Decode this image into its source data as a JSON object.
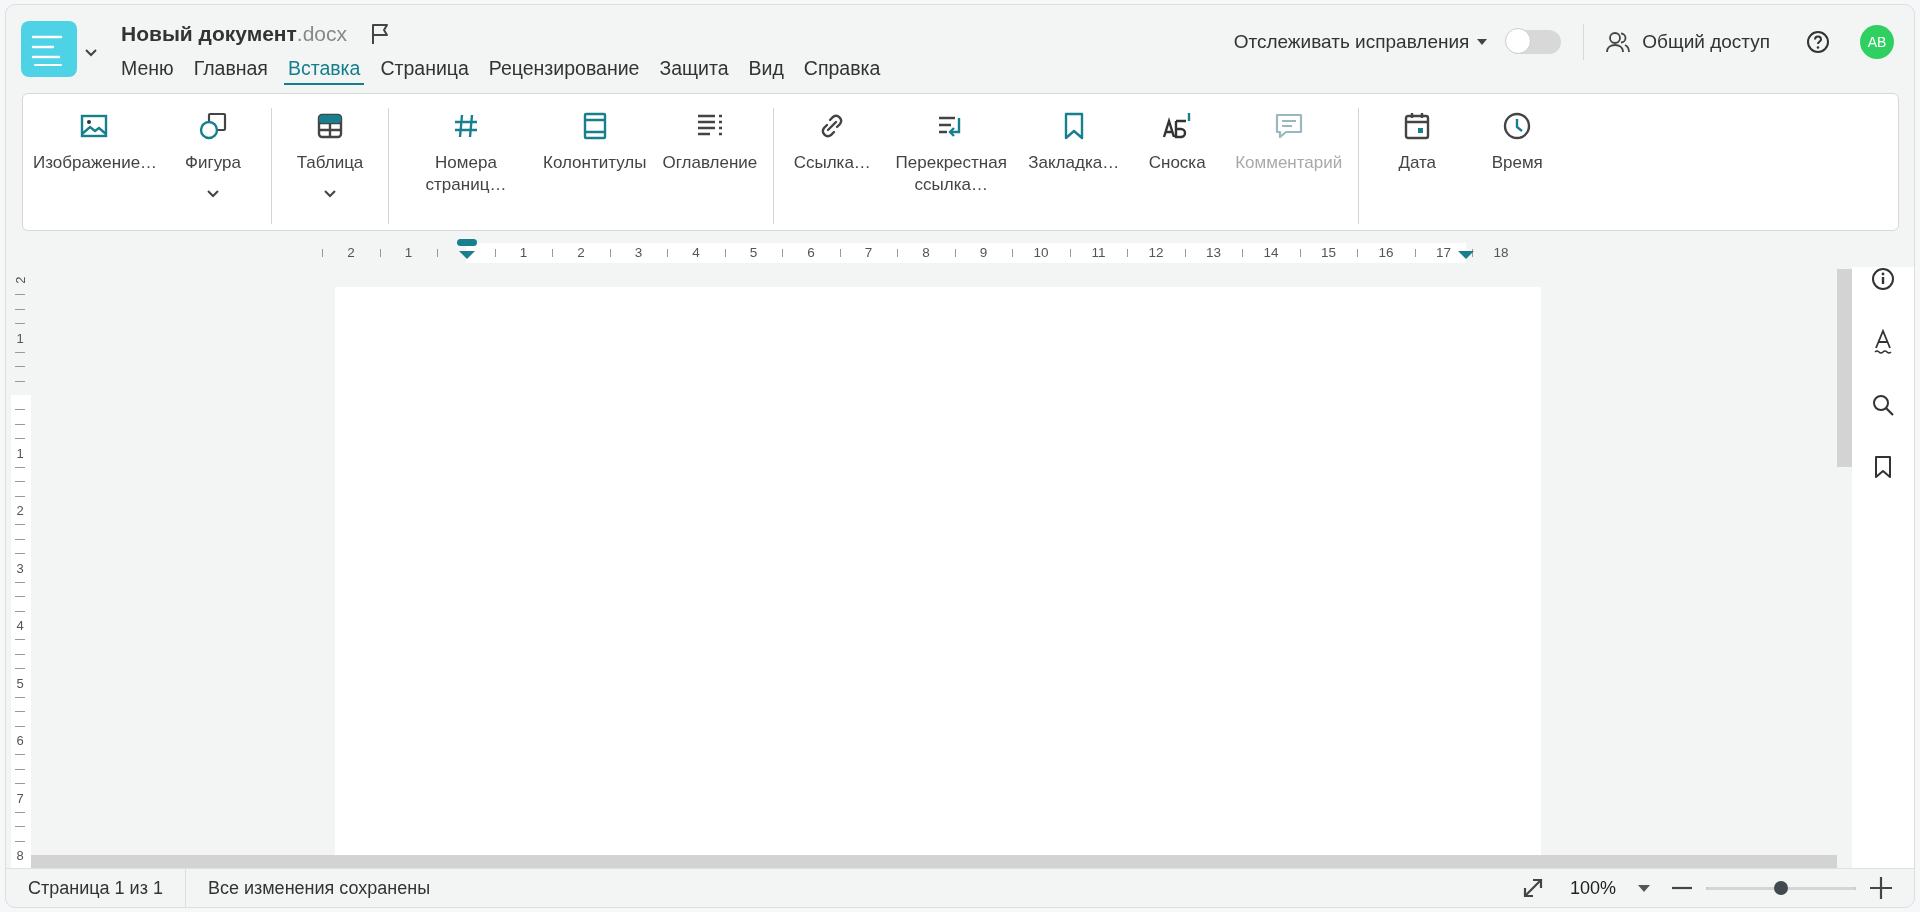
{
  "header": {
    "title": {
      "name": "Новый документ",
      "extension": ".docx"
    },
    "tabs": [
      {
        "label": "Меню",
        "selected": false
      },
      {
        "label": "Главная",
        "selected": false
      },
      {
        "label": "Вставка",
        "selected": true
      },
      {
        "label": "Страница",
        "selected": false
      },
      {
        "label": "Рецензирование",
        "selected": false
      },
      {
        "label": "Защита",
        "selected": false
      },
      {
        "label": "Вид",
        "selected": false
      },
      {
        "label": "Справка",
        "selected": false
      }
    ],
    "track_changes": {
      "label": "Отслеживать исправления",
      "on": false
    },
    "share": {
      "label": "Общий доступ"
    },
    "avatar": {
      "initials": "AB"
    }
  },
  "ribbon": {
    "groups": [
      [
        {
          "label": "Изображение…",
          "has_menu": false,
          "disabled": false
        },
        {
          "label": "Фигура",
          "has_menu": true,
          "disabled": false
        }
      ],
      [
        {
          "label": "Таблица",
          "has_menu": true,
          "disabled": false
        }
      ],
      [
        {
          "label": "Номера страниц…",
          "has_menu": false,
          "disabled": false
        },
        {
          "label": "Колонтитулы",
          "has_menu": false,
          "disabled": false
        },
        {
          "label": "Оглавление",
          "has_menu": false,
          "disabled": false
        }
      ],
      [
        {
          "label": "Ссылка…",
          "has_menu": false,
          "disabled": false
        },
        {
          "label": "Перекрестная ссылка…",
          "has_menu": false,
          "disabled": false
        },
        {
          "label": "Закладка…",
          "has_menu": false,
          "disabled": false
        },
        {
          "label": "Сноска",
          "has_menu": false,
          "disabled": false
        },
        {
          "label": "Комментарий",
          "has_menu": false,
          "disabled": true
        }
      ],
      [
        {
          "label": "Дата",
          "has_menu": false,
          "disabled": false
        },
        {
          "label": "Время",
          "has_menu": false,
          "disabled": false
        }
      ]
    ]
  },
  "ruler": {
    "labels": [
      "2",
      "1",
      "1",
      "2",
      "3",
      "4",
      "5",
      "6",
      "7",
      "8",
      "9",
      "10",
      "11",
      "12",
      "13",
      "14",
      "15",
      "16",
      "17",
      "18"
    ]
  },
  "vertical_ruler": {
    "labels": [
      "2",
      "1",
      "1",
      "2",
      "3",
      "4",
      "5",
      "6",
      "7",
      "8"
    ]
  },
  "status_bar": {
    "page": "Страница 1 из 1",
    "save_state": "Все изменения сохранены",
    "zoom": {
      "value": "100%",
      "level": 0.5
    }
  }
}
